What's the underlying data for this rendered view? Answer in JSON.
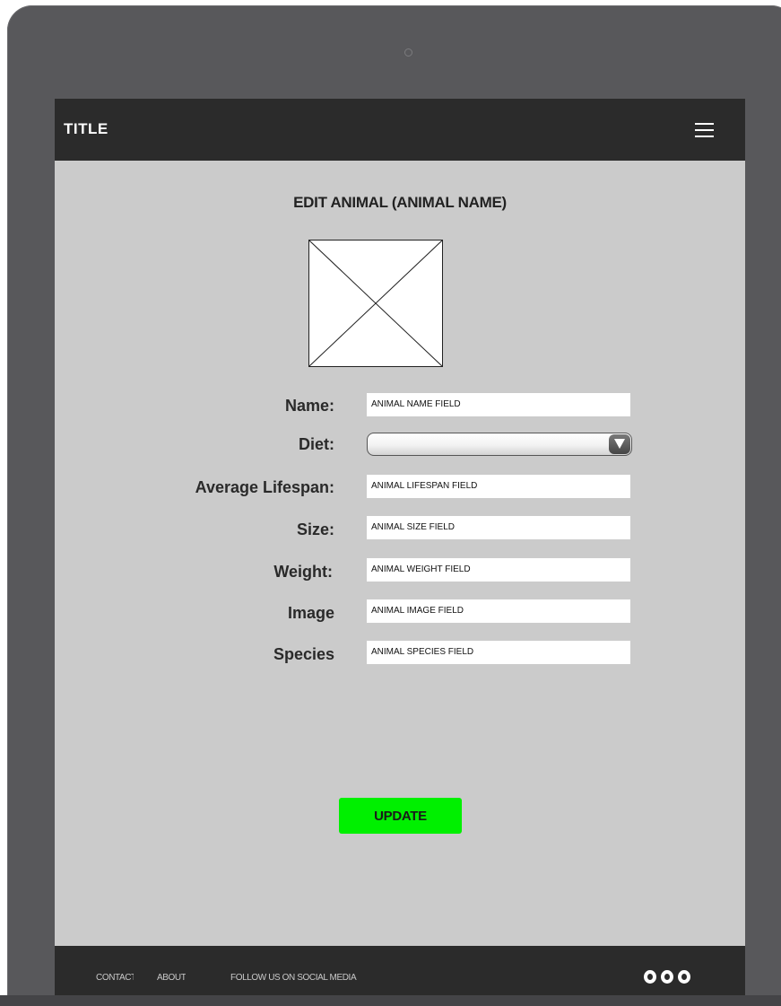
{
  "header": {
    "title": "TITLE",
    "menu_icon": "hamburger-menu-icon"
  },
  "page": {
    "heading": "EDIT ANIMAL (ANIMAL NAME)",
    "image_icon": "image-placeholder-icon"
  },
  "form": {
    "name_label": "Name:",
    "name_value": "ANIMAL NAME FIELD",
    "diet_label": "Diet:",
    "diet_value": "",
    "lifespan_label": "Average Lifespan:",
    "lifespan_value": "ANIMAL LIFESPAN FIELD",
    "size_label": "Size:",
    "size_value": "ANIMAL SIZE FIELD",
    "weight_label": "Weight:",
    "weight_value": "ANIMAL WEIGHT FIELD",
    "image_label": "Image",
    "image_value": "ANIMAL IMAGE FIELD",
    "species_label": "Species",
    "species_value": "ANIMAL SPECIES FIELD"
  },
  "actions": {
    "update_label": "UPDATE",
    "update_color": "#00f000"
  },
  "footer": {
    "contact": "CONTACT",
    "about": "ABOUT",
    "social_text": "FOLLOW US ON SOCIAL MEDIA",
    "social_icons": [
      "social-icon-1",
      "social-icon-2",
      "social-icon-3"
    ]
  },
  "colors": {
    "header_bg": "#2b2b2b",
    "page_bg": "#cbcbcb",
    "device_frame": "#58585b"
  }
}
